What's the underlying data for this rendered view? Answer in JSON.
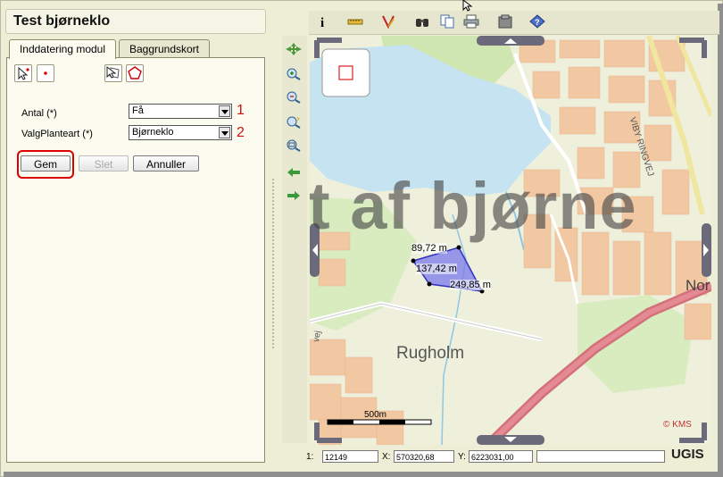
{
  "panel": {
    "title": "Test bjørneklo",
    "tabs": [
      {
        "label": "Inddatering modul",
        "active": true
      },
      {
        "label": "Baggrundskort",
        "active": false
      }
    ],
    "fields": [
      {
        "label": "Antal (*)",
        "value": "Få",
        "marker": "1"
      },
      {
        "label": "ValgPlanteart (*)",
        "value": "Bjørneklo",
        "marker": "2"
      }
    ],
    "buttons": {
      "save": "Gem",
      "delete": "Slet",
      "cancel": "Annuller"
    }
  },
  "map": {
    "watermark": "t af bjørne",
    "places": [
      "Rugholm",
      "Nor",
      "VIBY RINGVEJ",
      "vej"
    ],
    "measurements": [
      "89,72 m",
      "137,42 m",
      "249,85 m"
    ],
    "scale_label": "500m",
    "copyright": "© KMS"
  },
  "status": {
    "scale_prefix": "1:",
    "scale": "12149",
    "x_label": "X:",
    "x": "570320,68",
    "y_label": "Y:",
    "y": "6223031,00",
    "logo": "UGIS"
  },
  "colors": {
    "highlight": "#dd0000",
    "polygon": "#7a7aee",
    "water": "#c5e3f0",
    "road": "#d4707a"
  }
}
